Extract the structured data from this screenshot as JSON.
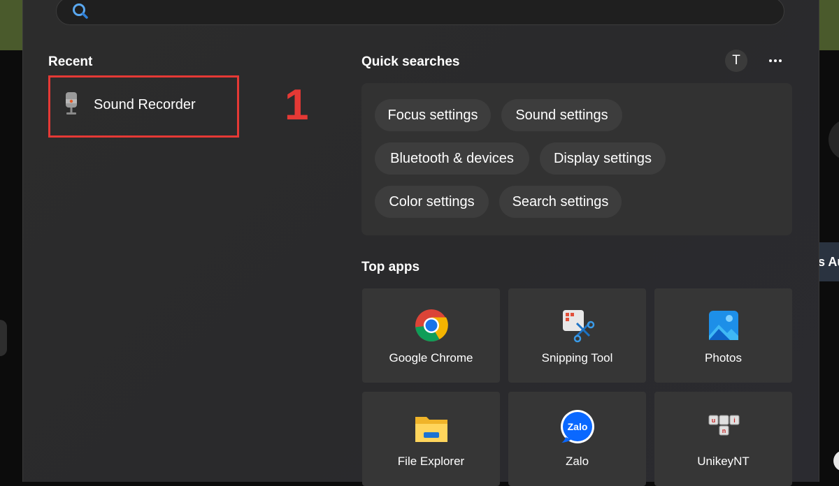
{
  "search": {
    "placeholder": ""
  },
  "recent": {
    "title": "Recent",
    "items": [
      {
        "label": "Sound Recorder",
        "icon": "microphone-icon"
      }
    ]
  },
  "annotation": {
    "step": "1",
    "color": "#e53935"
  },
  "quick_searches": {
    "title": "Quick searches",
    "avatar_initial": "T",
    "chips": [
      "Focus settings",
      "Sound settings",
      "Bluetooth & devices",
      "Display settings",
      "Color settings",
      "Search settings"
    ]
  },
  "top_apps": {
    "title": "Top apps",
    "apps": [
      {
        "label": "Google Chrome",
        "icon": "chrome-icon"
      },
      {
        "label": "Snipping Tool",
        "icon": "snipping-tool-icon"
      },
      {
        "label": "Photos",
        "icon": "photos-icon"
      },
      {
        "label": "File Explorer",
        "icon": "file-explorer-icon"
      },
      {
        "label": "Zalo",
        "icon": "zalo-icon"
      },
      {
        "label": "UnikeyNT",
        "icon": "unikey-icon"
      }
    ]
  },
  "background": {
    "right_text": "s Au"
  }
}
